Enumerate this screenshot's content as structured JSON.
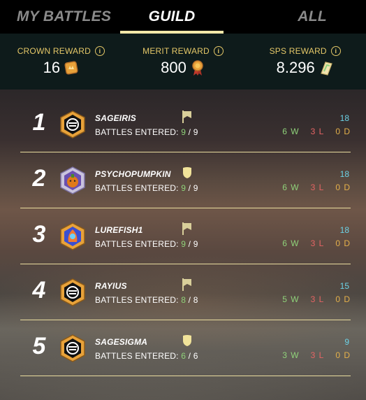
{
  "tabs": [
    {
      "label": "MY BATTLES",
      "active": false
    },
    {
      "label": "GUILD",
      "active": true
    },
    {
      "label": "ALL",
      "active": false
    }
  ],
  "rewards": {
    "crown": {
      "label": "CROWN REWARD",
      "value": "16",
      "icon": "crown-token-icon"
    },
    "merit": {
      "label": "MERIT REWARD",
      "value": "800",
      "icon": "merit-medal-icon"
    },
    "sps": {
      "label": "SPS REWARD",
      "value": "8.296",
      "icon": "sps-token-icon"
    }
  },
  "battles_label": "BATTLES ENTERED:",
  "players": [
    {
      "rank": "1",
      "name": "SAGEIRIS",
      "entered": "9",
      "total": "9",
      "points": "18",
      "wins": "6 W",
      "losses": "3 L",
      "draws": "0 D",
      "badge": "banner-icon",
      "avatar": "skull-frame-icon"
    },
    {
      "rank": "2",
      "name": "PSYCHOPUMPKIN",
      "entered": "9",
      "total": "9",
      "points": "18",
      "wins": "6 W",
      "losses": "3 L",
      "draws": "0 D",
      "badge": "shield-icon",
      "avatar": "pumpkin-avatar"
    },
    {
      "rank": "3",
      "name": "LUREFISH1",
      "entered": "9",
      "total": "9",
      "points": "18",
      "wins": "6 W",
      "losses": "3 L",
      "draws": "0 D",
      "badge": "banner-icon",
      "avatar": "fire-creature-avatar"
    },
    {
      "rank": "4",
      "name": "RAYIUS",
      "entered": "8",
      "total": "8",
      "points": "15",
      "wins": "5 W",
      "losses": "3 L",
      "draws": "0 D",
      "badge": "banner-icon",
      "avatar": "skull-frame-icon"
    },
    {
      "rank": "5",
      "name": "SAGESIGMA",
      "entered": "6",
      "total": "6",
      "points": "9",
      "wins": "3 W",
      "losses": "3 L",
      "draws": "0 D",
      "badge": "shield-icon",
      "avatar": "skull-frame-icon"
    }
  ],
  "colors": {
    "accent": "#f3e7a8",
    "gold_label": "#e4c768",
    "wins": "#8fd27a",
    "losses": "#e56464",
    "draws": "#e4b04a",
    "points": "#6cd2e6"
  }
}
